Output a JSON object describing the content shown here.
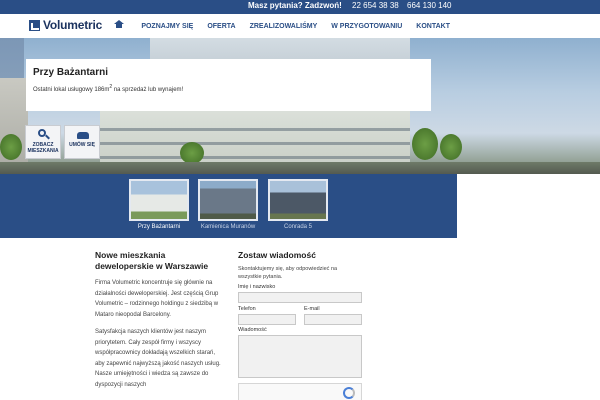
{
  "topbar": {
    "question": "Masz pytania? Zadzwoń!",
    "phone1": "22 654 38 38",
    "phone2": "664 130 140"
  },
  "header": {
    "logo_text": "Volumetric",
    "nav": [
      {
        "label": "POZNAJMY SIĘ"
      },
      {
        "label": "OFERTA"
      },
      {
        "label": "ZREALIZOWALIŚMY"
      },
      {
        "label": "W PRZYGOTOWANIU"
      },
      {
        "label": "KONTAKT"
      }
    ]
  },
  "hero": {
    "title": "Przy Bażantarni",
    "desc_prefix": "Ostatni lokal usługowy 186m",
    "desc_sup": "2",
    "desc_suffix": " na sprzedaż lub wynajem!",
    "buttons": [
      {
        "label_line1": "ZOBACZ",
        "label_line2": "MIESZKANIA",
        "icon": "search-icon"
      },
      {
        "label_line1": "UMÓW SIĘ",
        "label_line2": "",
        "icon": "phone-icon"
      }
    ]
  },
  "thumbs": [
    {
      "caption": "Przy Bażantarni",
      "active": true
    },
    {
      "caption": "Kamienica Muranów",
      "active": false
    },
    {
      "caption": "Conrada 5",
      "active": false
    }
  ],
  "about": {
    "title": "Nowe mieszkania deweloperskie w Warszawie",
    "p1": "Firma Volumetric koncentruje się głównie na działalności deweloperskiej. Jest częścią Grup Volumetric – rodzinnego holdingu z siedzibą w Mataro nieopodal Barcelony.",
    "p2": "Satysfakcja naszych klientów jest naszym priorytetem. Cały zespół firmy i wszyscy współpracownicy dokładają wszelkich starań, aby zapewnić najwyższą jakość naszych usług. Nasze umiejętności i wiedza są zawsze do dyspozycji naszych"
  },
  "contact": {
    "title": "Zostaw wiadomość",
    "intro": "Skontaktujemy się, aby odpowiedzieć na wszystkie pytania.",
    "name_label": "Imię i nazwisko",
    "phone_label": "Telefon",
    "email_label": "E-mail",
    "message_label": "Wiadomość"
  },
  "colors": {
    "brand_blue": "#2a4e86",
    "dark_blue": "#1d3460"
  }
}
